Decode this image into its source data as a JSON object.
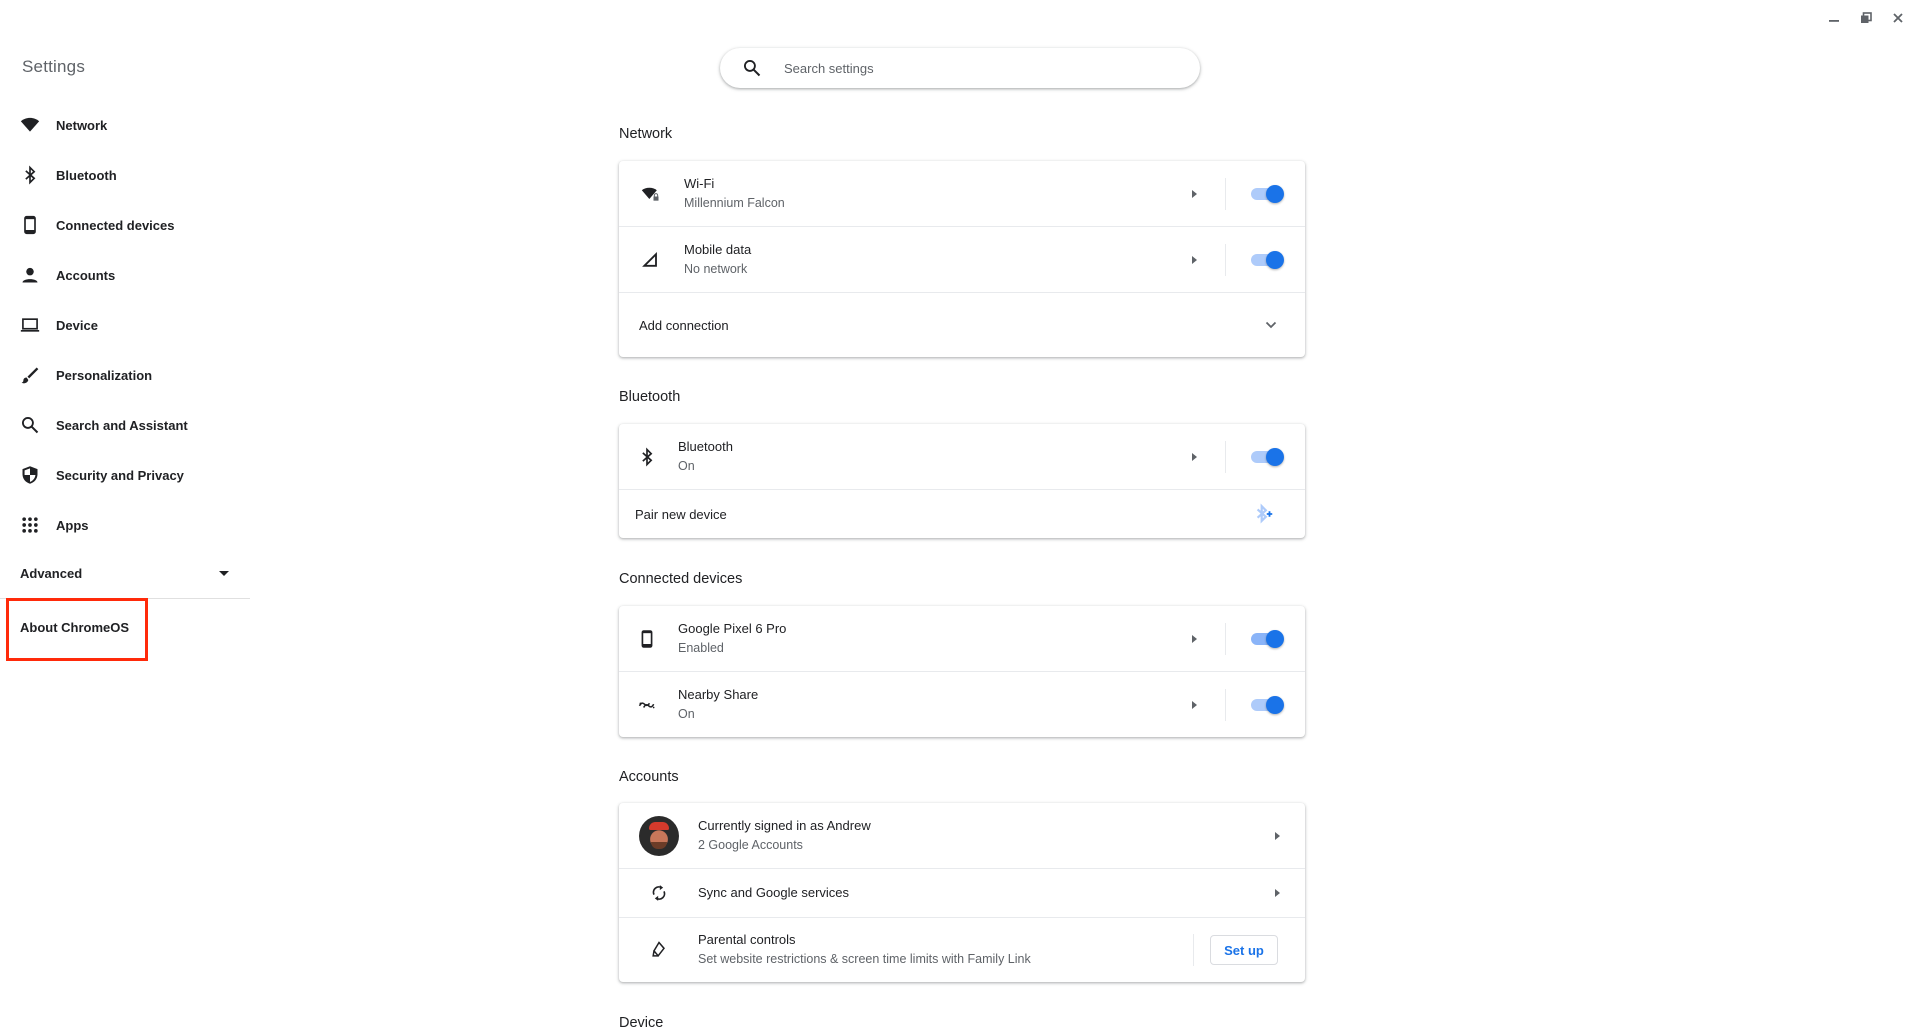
{
  "window": {
    "controls": [
      {
        "name": "minimize",
        "icon": "minimize-icon"
      },
      {
        "name": "restore",
        "icon": "restore-icon"
      },
      {
        "name": "close",
        "icon": "close-icon"
      }
    ]
  },
  "sidebar": {
    "title": "Settings",
    "items": [
      {
        "label": "Network",
        "icon": "wifi-icon"
      },
      {
        "label": "Bluetooth",
        "icon": "bluetooth-icon"
      },
      {
        "label": "Connected devices",
        "icon": "phone-icon"
      },
      {
        "label": "Accounts",
        "icon": "person-icon"
      },
      {
        "label": "Device",
        "icon": "laptop-icon"
      },
      {
        "label": "Personalization",
        "icon": "brush-icon"
      },
      {
        "label": "Search and Assistant",
        "icon": "search-icon"
      },
      {
        "label": "Security and Privacy",
        "icon": "shield-icon"
      },
      {
        "label": "Apps",
        "icon": "apps-grid-icon"
      }
    ],
    "advanced_label": "Advanced",
    "about_label": "About ChromeOS",
    "highlight_color": "#ff2a0a"
  },
  "search": {
    "placeholder": "Search settings",
    "value": ""
  },
  "sections": {
    "network": {
      "title": "Network",
      "wifi": {
        "title": "Wi-Fi",
        "subtitle": "Millennium Falcon",
        "enabled": true
      },
      "mobile": {
        "title": "Mobile data",
        "subtitle": "No network",
        "enabled": true
      },
      "add_connection": "Add connection"
    },
    "bluetooth": {
      "title": "Bluetooth",
      "bluetooth": {
        "title": "Bluetooth",
        "subtitle": "On",
        "enabled": true
      },
      "pair_new": "Pair new device"
    },
    "connected": {
      "title": "Connected devices",
      "phone": {
        "title": "Google Pixel 6 Pro",
        "subtitle": "Enabled",
        "enabled": true
      },
      "nearby": {
        "title": "Nearby Share",
        "subtitle": "On",
        "enabled": true
      }
    },
    "accounts": {
      "title": "Accounts",
      "signed_in": {
        "title": "Currently signed in as Andrew",
        "subtitle": "2 Google Accounts"
      },
      "sync": {
        "title": "Sync and Google services"
      },
      "parental": {
        "title": "Parental controls",
        "subtitle": "Set website restrictions & screen time limits with Family Link",
        "button": "Set up"
      }
    },
    "device": {
      "title": "Device"
    }
  },
  "colors": {
    "accent": "#1a73e8",
    "toggle_track": "#aecbfa",
    "text_primary": "#202124",
    "text_secondary": "#5f6368"
  }
}
